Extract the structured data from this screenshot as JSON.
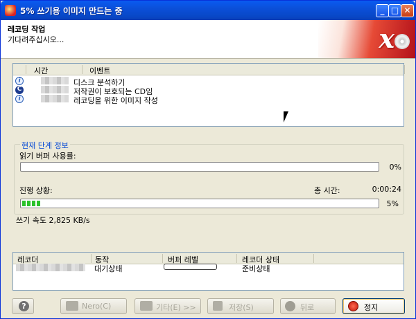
{
  "window": {
    "title": "5% 쓰기용 이미지 만드는 중",
    "controls": {
      "minimize": "_",
      "maximize": "□",
      "close": "✕"
    }
  },
  "header": {
    "title": "레코딩 작업",
    "subtitle": "기다려주십시오...",
    "logo_icon": "nero-logo-icon"
  },
  "event_log": {
    "columns": [
      "시간",
      "이벤트"
    ],
    "rows": [
      {
        "icon": "info-icon",
        "glyph": "i",
        "text": "디스크 분석하기"
      },
      {
        "icon": "copyright-icon",
        "glyph": "C",
        "text": "저작권이 보호되는 CD임"
      },
      {
        "icon": "info-icon",
        "glyph": "i",
        "text": "레코딩을 위한 이미지 작성"
      }
    ]
  },
  "stage_info": {
    "group_label": "현재 단계 정보",
    "buffer_label": "읽기 버퍼 사용률:",
    "buffer_value": "0%",
    "buffer_level": 0,
    "progress_label": "진행 상황:",
    "total_time_label": "총 시간:",
    "total_time_value": "0:00:24",
    "progress_value": "5%",
    "progress_level": 0.05,
    "progress_color": "#2bc22b"
  },
  "write_speed": "쓰기 속도 2,825 KB/s",
  "recorder_table": {
    "columns": [
      "레코더",
      "동작",
      "버퍼 레벨",
      "레코더 상태"
    ],
    "row": {
      "action": "대기상태",
      "buffer_level": 0,
      "status": "준비상태"
    }
  },
  "buttons": {
    "help": "?",
    "nero": "Nero(C)",
    "more": "기타(E) >>",
    "save": "저장(S)",
    "back": "뒤로",
    "stop": "정지"
  },
  "colors": {
    "titlebar": "#0b4fd9",
    "group_label": "#0046d5",
    "window_bg": "#ece9d8"
  }
}
